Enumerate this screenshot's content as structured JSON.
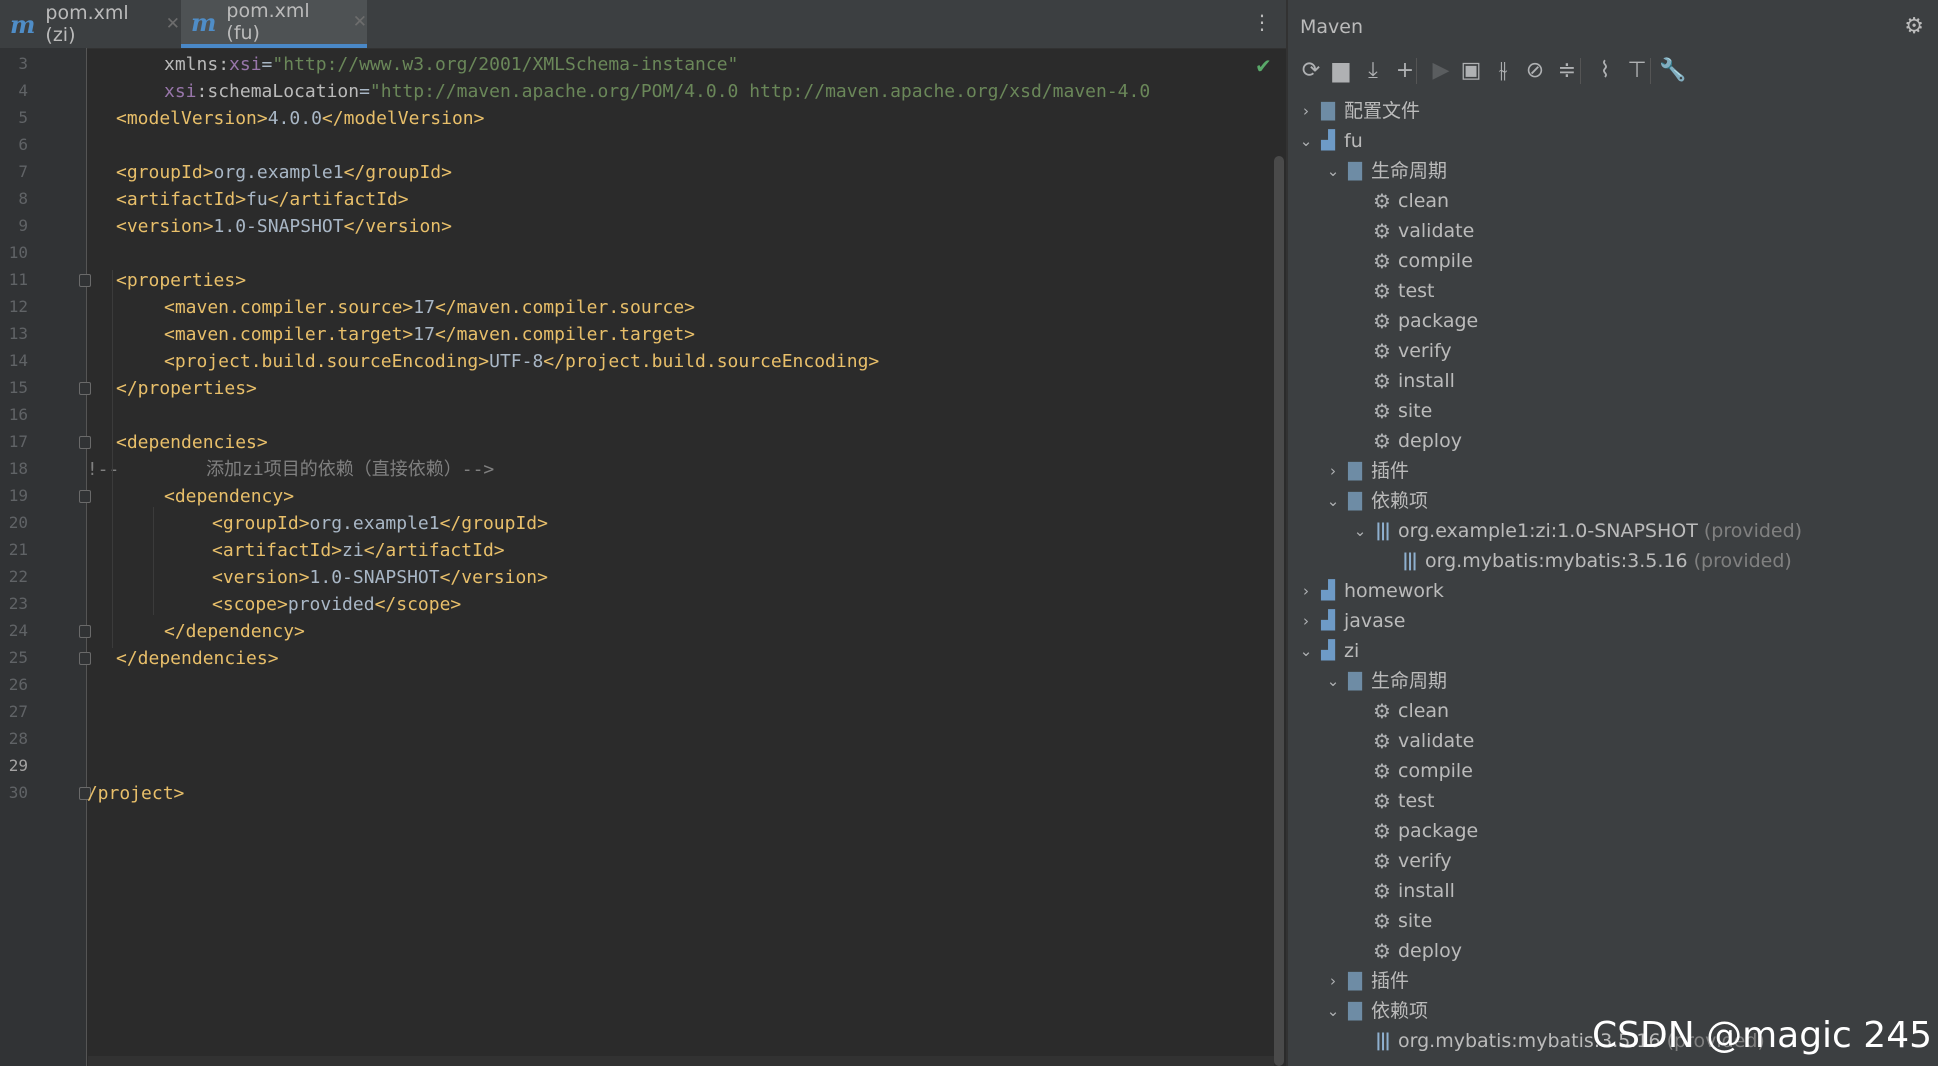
{
  "tabs": [
    {
      "label": "pom.xml (zi)",
      "icon": "maven-m-icon",
      "active": false
    },
    {
      "label": "pom.xml (fu)",
      "icon": "maven-m-icon",
      "active": true
    }
  ],
  "tab_menu_glyph": "⋮",
  "editor": {
    "line_numbers": [
      "3",
      "4",
      "5",
      "6",
      "7",
      "8",
      "9",
      "10",
      "11",
      "12",
      "13",
      "14",
      "15",
      "16",
      "17",
      "18",
      "19",
      "20",
      "21",
      "22",
      "23",
      "24",
      "25",
      "26",
      "27",
      "28",
      "29",
      "30"
    ],
    "current_line": "29",
    "code": {
      "l3": {
        "ns_attr": "xmlns",
        "sep": ":",
        "attr": "xsi",
        "eq": "=",
        "val": "\"http://www.w3.org/2001/XMLSchema-instance\""
      },
      "l4": {
        "ns": "xsi",
        "sep": ":",
        "attr": "schemaLocation",
        "eq": "=",
        "val": "\"http://maven.apache.org/POM/4.0.0 http://maven.apache.org/xsd/maven-4.0"
      },
      "l5": {
        "open": "<modelVersion>",
        "text": "4.0.0",
        "close": "</modelVersion>"
      },
      "l7": {
        "open": "<groupId>",
        "text": "org.example1",
        "close": "</groupId>"
      },
      "l8": {
        "open": "<artifactId>",
        "text": "fu",
        "close": "</artifactId>"
      },
      "l9": {
        "open": "<version>",
        "text": "1.0-SNAPSHOT",
        "close": "</version>"
      },
      "l11": {
        "open": "<properties>"
      },
      "l12": {
        "open": "<maven.compiler.source>",
        "text": "17",
        "close": "</maven.compiler.source>"
      },
      "l13": {
        "open": "<maven.compiler.target>",
        "text": "17",
        "close": "</maven.compiler.target>"
      },
      "l14": {
        "open": "<project.build.sourceEncoding>",
        "text": "UTF-8",
        "close": "</project.build.sourceEncoding>"
      },
      "l15": {
        "close": "</properties>"
      },
      "l17": {
        "open": "<dependencies>"
      },
      "l18": {
        "comment_start": "<!--",
        "comment_text": "添加zi项目的依赖（直接依赖）-->"
      },
      "l19": {
        "open": "<dependency>"
      },
      "l20": {
        "open": "<groupId>",
        "text": "org.example1",
        "close": "</groupId>"
      },
      "l21": {
        "open": "<artifactId>",
        "text": "zi",
        "close": "</artifactId>"
      },
      "l22": {
        "open": "<version>",
        "text": "1.0-SNAPSHOT",
        "close": "</version>"
      },
      "l23": {
        "open": "<scope>",
        "text": "provided",
        "close": "</scope>"
      },
      "l24": {
        "close": "</dependency>"
      },
      "l25": {
        "close": "</dependencies>"
      },
      "l30": {
        "close": "</project>"
      }
    },
    "status_glyph": "✔"
  },
  "maven": {
    "title": "Maven",
    "settings_glyph": "⚙",
    "toolbar": [
      {
        "name": "reload-icon",
        "glyph": "⟳"
      },
      {
        "name": "add-folder-icon",
        "glyph": "▆"
      },
      {
        "name": "download-icon",
        "glyph": "⤓"
      },
      {
        "name": "add-icon",
        "glyph": "+"
      },
      {
        "name": "run-icon",
        "glyph": "▶"
      },
      {
        "name": "execute-goal-icon",
        "glyph": "▣"
      },
      {
        "name": "toggle-offline-icon",
        "glyph": "⫳"
      },
      {
        "name": "skip-tests-icon",
        "glyph": "⊘"
      },
      {
        "name": "collapse-all-icon",
        "glyph": "≑"
      },
      {
        "name": "show-dependencies-icon",
        "glyph": "⌇"
      },
      {
        "name": "expand-all-icon",
        "glyph": "⊤"
      },
      {
        "name": "wrench-icon",
        "glyph": "🔧"
      }
    ],
    "tree": [
      {
        "label": "配置文件",
        "arrow": "›",
        "icon": "profiles-icon",
        "glyph": "▇",
        "level": 0
      },
      {
        "label": "fu",
        "arrow": "⌄",
        "icon": "module-icon",
        "glyph": "▟",
        "level": 0
      },
      {
        "label": "生命周期",
        "arrow": "⌄",
        "icon": "lifecycle-folder-icon",
        "glyph": "▇",
        "level": 1
      },
      {
        "label": "clean",
        "icon": "goal-gear-icon",
        "glyph": "⚙",
        "level": 2
      },
      {
        "label": "validate",
        "icon": "goal-gear-icon",
        "glyph": "⚙",
        "level": 2
      },
      {
        "label": "compile",
        "icon": "goal-gear-icon",
        "glyph": "⚙",
        "level": 2
      },
      {
        "label": "test",
        "icon": "goal-gear-icon",
        "glyph": "⚙",
        "level": 2
      },
      {
        "label": "package",
        "icon": "goal-gear-icon",
        "glyph": "⚙",
        "level": 2
      },
      {
        "label": "verify",
        "icon": "goal-gear-icon",
        "glyph": "⚙",
        "level": 2
      },
      {
        "label": "install",
        "icon": "goal-gear-icon",
        "glyph": "⚙",
        "level": 2
      },
      {
        "label": "site",
        "icon": "goal-gear-icon",
        "glyph": "⚙",
        "level": 2
      },
      {
        "label": "deploy",
        "icon": "goal-gear-icon",
        "glyph": "⚙",
        "level": 2
      },
      {
        "label": "插件",
        "arrow": "›",
        "icon": "plugins-folder-icon",
        "glyph": "▇",
        "level": 1
      },
      {
        "label": "依赖项",
        "arrow": "⌄",
        "icon": "dependencies-folder-icon",
        "glyph": "▇",
        "level": 1
      },
      {
        "label": "org.example1:zi:1.0-SNAPSHOT",
        "suffix": "(provided)",
        "arrow": "⌄",
        "icon": "library-icon",
        "glyph": "|||",
        "level": 2
      },
      {
        "label": "org.mybatis:mybatis:3.5.16",
        "suffix": "(provided)",
        "icon": "library-icon",
        "glyph": "|||",
        "level": 3
      },
      {
        "label": "homework",
        "arrow": "›",
        "icon": "module-icon",
        "glyph": "▟",
        "level": 0
      },
      {
        "label": "javase",
        "arrow": "›",
        "icon": "module-icon",
        "glyph": "▟",
        "level": 0
      },
      {
        "label": "zi",
        "arrow": "⌄",
        "icon": "module-icon",
        "glyph": "▟",
        "level": 0
      },
      {
        "label": "生命周期",
        "arrow": "⌄",
        "icon": "lifecycle-folder-icon",
        "glyph": "▇",
        "level": 1
      },
      {
        "label": "clean",
        "icon": "goal-gear-icon",
        "glyph": "⚙",
        "level": 2
      },
      {
        "label": "validate",
        "icon": "goal-gear-icon",
        "glyph": "⚙",
        "level": 2
      },
      {
        "label": "compile",
        "icon": "goal-gear-icon",
        "glyph": "⚙",
        "level": 2
      },
      {
        "label": "test",
        "icon": "goal-gear-icon",
        "glyph": "⚙",
        "level": 2
      },
      {
        "label": "package",
        "icon": "goal-gear-icon",
        "glyph": "⚙",
        "level": 2
      },
      {
        "label": "verify",
        "icon": "goal-gear-icon",
        "glyph": "⚙",
        "level": 2
      },
      {
        "label": "install",
        "icon": "goal-gear-icon",
        "glyph": "⚙",
        "level": 2
      },
      {
        "label": "site",
        "icon": "goal-gear-icon",
        "glyph": "⚙",
        "level": 2
      },
      {
        "label": "deploy",
        "icon": "goal-gear-icon",
        "glyph": "⚙",
        "level": 2
      },
      {
        "label": "插件",
        "arrow": "›",
        "icon": "plugins-folder-icon",
        "glyph": "▇",
        "level": 1
      },
      {
        "label": "依赖项",
        "arrow": "⌄",
        "icon": "dependencies-folder-icon",
        "glyph": "▇",
        "level": 1
      },
      {
        "label": "org.mybatis:mybatis:3.5.16",
        "suffix": "(provided)",
        "icon": "library-icon",
        "glyph": "|||",
        "level": 2
      }
    ]
  },
  "watermark": "CSDN @magic 245"
}
